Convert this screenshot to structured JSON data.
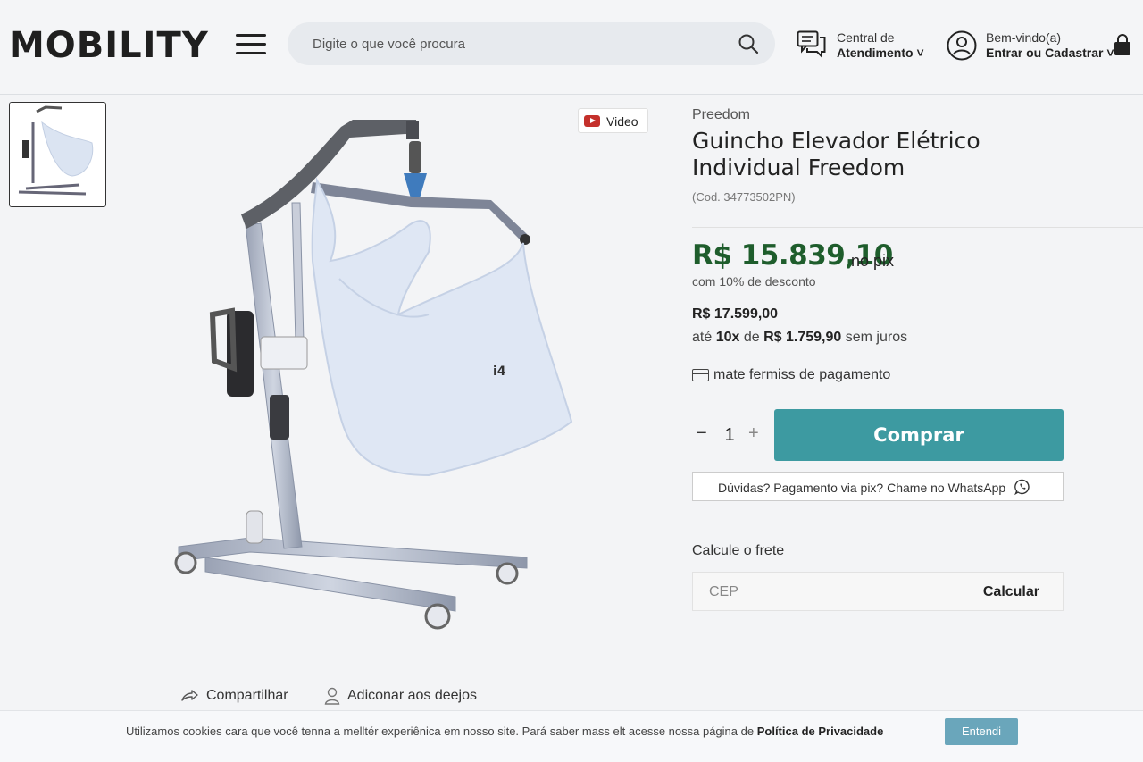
{
  "header": {
    "logo": "MOBILITY",
    "search_placeholder": "Digite o que você procura",
    "service_line1": "Central de",
    "service_line2": "Atendimento ˅",
    "account_line1": "Bem-vindo(a)",
    "account_line2": "Entrar ou Cadastrar ˅"
  },
  "gallery": {
    "video_label": "Video"
  },
  "product": {
    "brand": "Preedom",
    "title": "Guincho Elevador Elétrico Individual Freedom",
    "code": "(Cod. 34773502PN)",
    "price_pix": "R$ 15.839,10",
    "pix_suffix": "no pix",
    "discount_note": "com 10% de desconto",
    "price_full": "R$ 17.599,00",
    "installment_prefix": "até",
    "installment_count": "10x",
    "installment_mid": "de",
    "installment_value": "R$ 1.759,90",
    "installment_suffix": "sem juros",
    "payment_link": "mate fermiss de pagamento",
    "quantity": "1",
    "qty_minus": "−",
    "qty_plus": "+",
    "buy_label": "Comprar",
    "whatsapp_label": "Dúvidas? Pagamento via pix? Chame no WhatsApp"
  },
  "shipping": {
    "title": "Calcule o frete",
    "cep_placeholder": "CEP",
    "calc_label": "Calcular"
  },
  "actions": {
    "share_label": "Compartilhar",
    "wishlist_label": "Adiconar aos deejos"
  },
  "cookie": {
    "text": "Utilizamos cookies cara que você tenna a melltér experiênica em nosso site. Pará saber mass elt acesse nossa página de",
    "policy_link": "Política de Privacidade",
    "accept_label": "Entendi"
  },
  "colors": {
    "buy_button": "#3d9aa1",
    "pix_price": "#1e5d2c",
    "cookie_button": "#6aa6bb"
  }
}
